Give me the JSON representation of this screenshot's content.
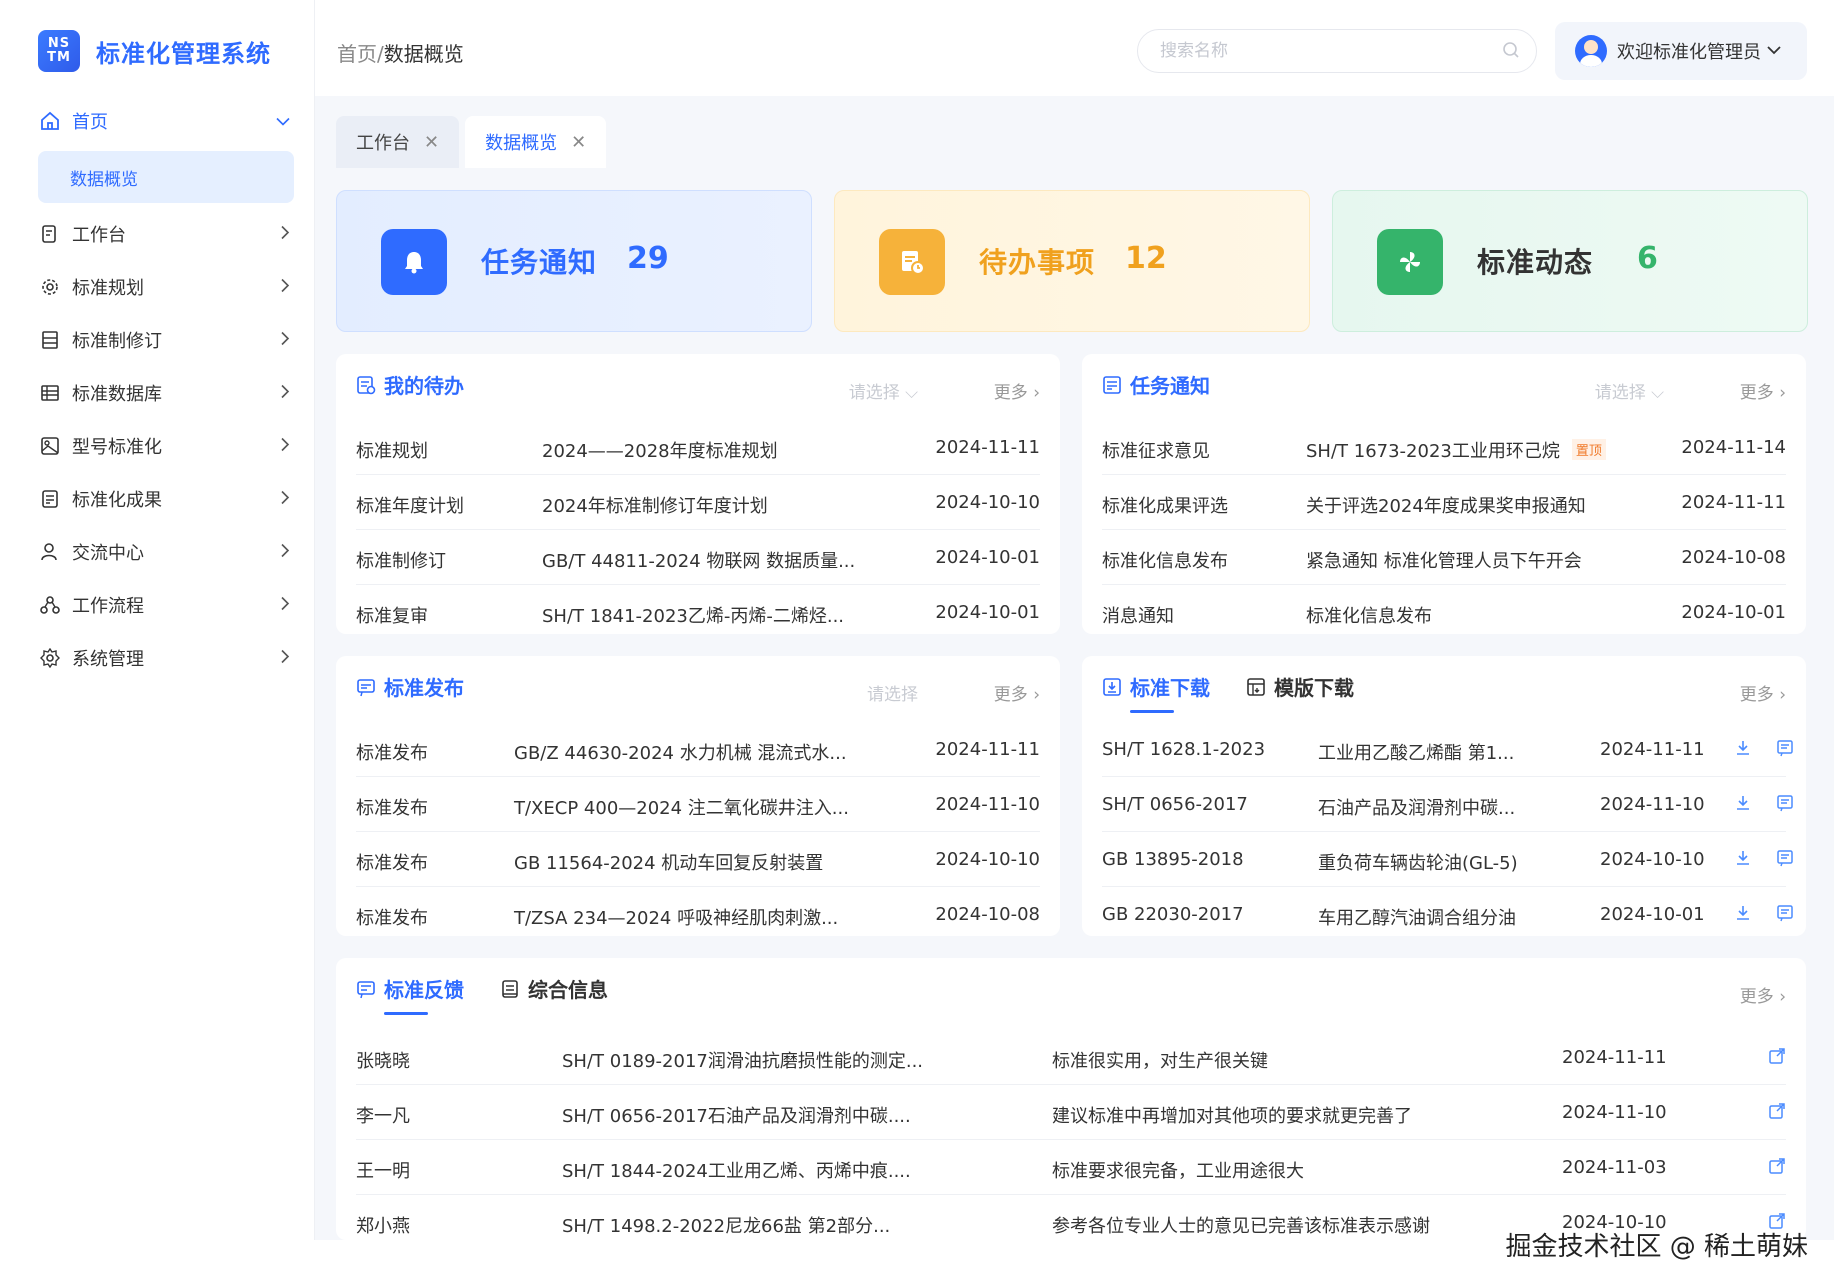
{
  "app": {
    "logo_mark_line1": "NS",
    "logo_mark_line2": "TM",
    "title": "标准化管理系统",
    "accent": "#2f6bff"
  },
  "sidebar": {
    "items": [
      {
        "label": "首页",
        "icon": "home-icon"
      },
      {
        "label": "工作台",
        "icon": "workbench-icon"
      },
      {
        "label": "标准规划",
        "icon": "gear-icon"
      },
      {
        "label": "标准制修订",
        "icon": "form-icon"
      },
      {
        "label": "标准数据库",
        "icon": "database-icon"
      },
      {
        "label": "型号标准化",
        "icon": "model-icon"
      },
      {
        "label": "标准化成果",
        "icon": "result-icon"
      },
      {
        "label": "交流中心",
        "icon": "user-icon"
      },
      {
        "label": "工作流程",
        "icon": "flow-icon"
      },
      {
        "label": "系统管理",
        "icon": "settings-icon"
      }
    ],
    "sub_items": [
      {
        "label": "数据概览"
      }
    ]
  },
  "header": {
    "breadcrumb_home": "首页",
    "breadcrumb_sep": "/",
    "breadcrumb_current": "数据概览",
    "search_placeholder": "搜索名称",
    "welcome": "欢迎标准化管理员"
  },
  "tabs": [
    {
      "label": "工作台",
      "active": false
    },
    {
      "label": "数据概览",
      "active": true
    }
  ],
  "stats": [
    {
      "label": "任务通知",
      "value": "29",
      "color": "#2f6bff"
    },
    {
      "label": "待办事项",
      "value": "12",
      "color": "#f0a11e"
    },
    {
      "label": "标准动态",
      "value": "6",
      "color": "#35b46b"
    }
  ],
  "todo": {
    "title": "我的待办",
    "select": "请选择",
    "more": "更多",
    "rows": [
      [
        "标准规划",
        "2024——2028年度标准规划",
        "2024-11-11"
      ],
      [
        "标准年度计划",
        "2024年标准制修订年度计划",
        "2024-10-10"
      ],
      [
        "标准制修订",
        "GB/T 44811-2024 物联网 数据质量...",
        "2024-10-01"
      ],
      [
        "标准复审",
        "SH/T 1841-2023乙烯-丙烯-二烯烃...",
        "2024-10-01"
      ]
    ]
  },
  "notice": {
    "title": "任务通知",
    "select": "请选择",
    "more": "更多",
    "pin": "置顶",
    "rows": [
      [
        "标准征求意见",
        "SH/T 1673-2023工业用环己烷",
        "2024-11-14"
      ],
      [
        "标准化成果评选",
        "关于评选2024年度成果奖申报通知",
        "2024-11-11"
      ],
      [
        "标准化信息发布",
        "紧急通知 标准化管理人员下午开会",
        "2024-10-08"
      ],
      [
        "消息通知",
        "标准化信息发布",
        "2024-10-01"
      ]
    ]
  },
  "publish": {
    "title": "标准发布",
    "select": "请选择",
    "more": "更多",
    "rows": [
      [
        "标准发布",
        "GB/Z 44630-2024 水力机械 混流式水...",
        "2024-11-11"
      ],
      [
        "标准发布",
        "T/XECP 400—2024 注二氧化碳井注入...",
        "2024-11-10"
      ],
      [
        "标准发布",
        "GB 11564-2024  机动车回复反射装置",
        "2024-10-10"
      ],
      [
        "标准发布",
        "T/ZSA 234—2024 呼吸神经肌肉刺激...",
        "2024-10-08"
      ]
    ]
  },
  "download": {
    "title": "标准下载",
    "title2": "模版下载",
    "more": "更多",
    "rows": [
      [
        "SH/T 1628.1-2023",
        "工业用乙酸乙烯酯 第1...",
        "2024-11-11"
      ],
      [
        "SH/T 0656-2017",
        "石油产品及润滑剂中碳...",
        "2024-11-10"
      ],
      [
        "GB 13895-2018",
        "重负荷车辆齿轮油(GL-5)",
        "2024-10-10"
      ],
      [
        "GB 22030-2017",
        "车用乙醇汽油调合组分油",
        "2024-10-01"
      ]
    ]
  },
  "feedback": {
    "title": "标准反馈",
    "title2": "综合信息",
    "more": "更多",
    "rows": [
      [
        "张晓晓",
        "SH/T 0189-2017润滑油抗磨损性能的测定...",
        "标准很实用，对生产很关键",
        "2024-11-11"
      ],
      [
        "李一凡",
        "SH/T 0656-2017石油产品及润滑剂中碳....",
        "建议标准中再增加对其他项的要求就更完善了",
        "2024-11-10"
      ],
      [
        "王一明",
        "SH/T 1844-2024工业用乙烯、丙烯中痕....",
        "标准要求很完备，工业用途很大",
        "2024-11-03"
      ],
      [
        "郑小燕",
        "SH/T 1498.2-2022尼龙66盐 第2部分...",
        "参考各位专业人士的意见已完善该标准表示感谢",
        "2024-10-10"
      ]
    ]
  },
  "watermark": "掘金技术社区 @ 稀土萌妹"
}
